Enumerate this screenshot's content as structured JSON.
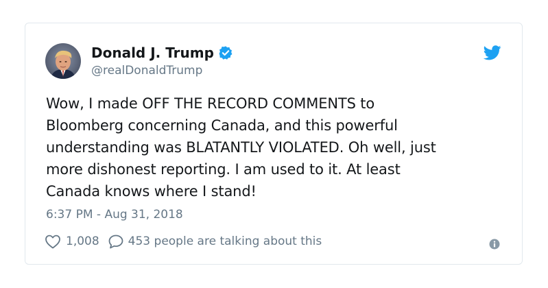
{
  "tweet": {
    "author": {
      "name": "Donald J. Trump",
      "handle": "@realDonaldTrump",
      "verified": true
    },
    "text_lines": [
      "Wow, I made OFF THE RECORD COMMENTS to",
      "Bloomberg concerning Canada, and this powerful",
      "understanding was BLATANTLY VIOLATED. Oh well, just",
      "more dishonest reporting. I am used to it. At least",
      "Canada knows where I stand!"
    ],
    "timestamp": "6:37 PM - Aug 31, 2018",
    "likes": "1,008",
    "conversation": "453 people are talking about this"
  },
  "icons": {
    "brand": "twitter-bird-icon",
    "verified": "verified-badge-icon",
    "like": "heart-icon",
    "reply": "speech-bubble-icon",
    "info": "info-icon"
  },
  "colors": {
    "brand_blue": "#1da1f2",
    "text_primary": "#14171a",
    "text_secondary": "#657786",
    "border": "#e1e8ed"
  }
}
